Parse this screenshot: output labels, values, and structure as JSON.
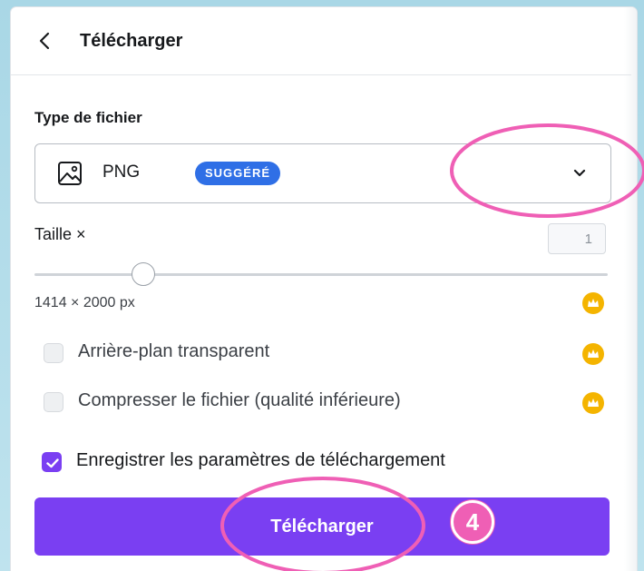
{
  "header": {
    "title": "Télécharger",
    "back_icon": "chevron-left-icon"
  },
  "file_type": {
    "label": "Type de fichier",
    "selected": "PNG",
    "badge": "SUGGÉRÉ",
    "icon": "image-icon",
    "dropdown_icon": "chevron-down-icon"
  },
  "size": {
    "label": "Taille ×",
    "scale_value": "1",
    "slider_fraction": 0.19,
    "dimensions": "1414 × 2000 px",
    "premium_icon": "crown-icon"
  },
  "options": [
    {
      "label": "Arrière-plan transparent",
      "checked": false,
      "premium": true
    },
    {
      "label": "Compresser le fichier (qualité inférieure)",
      "checked": false,
      "premium": true
    },
    {
      "label": "Enregistrer les paramètres de téléchargement",
      "checked": true,
      "premium": false
    }
  ],
  "download_button": {
    "label": "Télécharger"
  },
  "annotation": {
    "step_number": "4"
  },
  "colors": {
    "accent": "#7a3ff2",
    "badge": "#2f6fe6",
    "crown": "#f4b400",
    "highlight": "#ef5fb5"
  }
}
